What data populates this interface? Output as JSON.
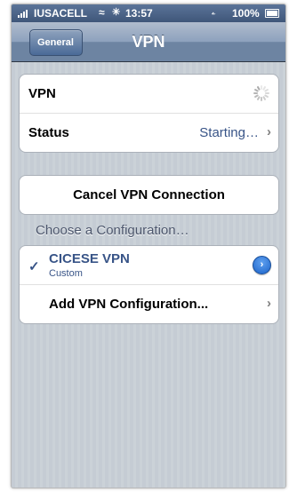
{
  "status_bar": {
    "carrier": "IUSACELL",
    "time": "13:57",
    "battery": "100%",
    "battery_level": 1.0,
    "icons": [
      "signal-icon",
      "wifi-icon",
      "activity-icon",
      "bluetooth-icon",
      "battery-icon"
    ]
  },
  "nav": {
    "back_label": "General",
    "title": "VPN"
  },
  "vpn_group": {
    "vpn_label": "VPN",
    "status_label": "Status",
    "status_value": "Starting…"
  },
  "cancel_button": "Cancel VPN Connection",
  "config_section": {
    "header": "Choose a Configuration…",
    "items": [
      {
        "name": "CICESE VPN",
        "subtitle": "Custom",
        "selected": true
      }
    ],
    "add_label": "Add VPN Configuration..."
  },
  "colors": {
    "nav_bar": "#6d84a2",
    "accent_text": "#385487",
    "detail_button": "#1c63c9",
    "background": "#c5ccd4"
  }
}
